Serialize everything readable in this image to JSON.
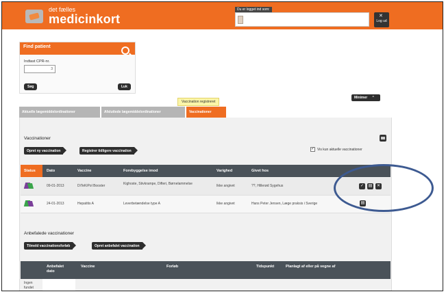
{
  "header": {
    "brand_small": "det fælles",
    "brand_big": "medicinkort",
    "login_label": "Du er logget ind som:",
    "logout_label": "Log ud"
  },
  "find_patient": {
    "title": "Find patient",
    "cpr_label": "Indtast CPR-nr.",
    "cpr_value": "3",
    "search_button": "Søg",
    "close_button": "Luk"
  },
  "tooltip": "Vaccination registreret",
  "minimize_label": "Minimer",
  "tabs": [
    {
      "label": "Aktuelle lægemiddelordinationer",
      "active": false
    },
    {
      "label": "Afsluttede lægemiddelordinationer",
      "active": false
    },
    {
      "label": "Vaccinationer",
      "active": true
    }
  ],
  "vaccinations": {
    "title": "Vaccinationer",
    "create_button": "Opret ny vaccination",
    "register_button": "Registrer tidligere vaccination",
    "checkbox_label": "Vis kun aktuelle vaccinationer",
    "checkbox_checked": true,
    "columns": [
      "Status",
      "Dato",
      "Vaccine",
      "Forebyggelse imod",
      "Varighed",
      "Givet hos"
    ],
    "rows": [
      {
        "date": "09-01-2013",
        "vaccine": "DiTeKiPol Booster",
        "prevention": "Kighoste, Stivkrampe, Difteri, Børnelammelse",
        "duration": "Ikke angivet",
        "given_at": "??, Hillerød Sygehus",
        "status_colors": [
          "#7b3f9a",
          "#3aa54a"
        ],
        "actions": [
          "confirm",
          "edit",
          "delete"
        ]
      },
      {
        "date": "24-01-2013",
        "vaccine": "Hepatitis A",
        "prevention": "Leverbetændelse type A",
        "duration": "Ikke angivet",
        "given_at": "Hans Peter Jensen, Læge praksis i Sverige",
        "status_colors": [
          "#3aa54a",
          "#7b3f9a"
        ],
        "actions": [
          "edit"
        ]
      }
    ]
  },
  "recommended": {
    "title": "Anbefalede vaccinationer",
    "course_button": "Tilmeld vaccinationsforløb",
    "create_button": "Opret anbefalet vaccination",
    "columns": [
      "Anbefalet dato",
      "Vaccine",
      "Forløb",
      "Tidspunkt",
      "Planlagt af eller på vegne af"
    ],
    "empty_text": "Ingen fundet"
  },
  "colors": {
    "accent": "#ef6d21",
    "table_header": "#4a5259",
    "highlight_ring": "#3d5a91"
  }
}
